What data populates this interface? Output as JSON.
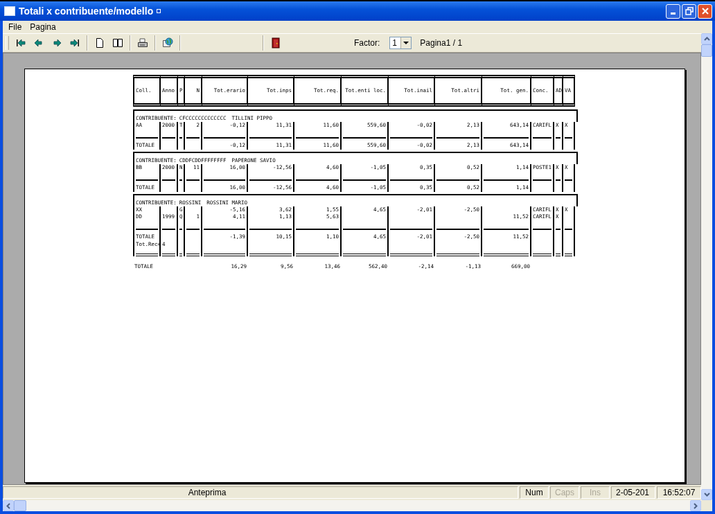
{
  "window": {
    "title": "Totali x contribuente/modello"
  },
  "menu": [
    {
      "label": "File"
    },
    {
      "label": "Pagina"
    }
  ],
  "toolbar": {
    "factor_label": "Factor:",
    "factor_value": "1",
    "page": "Pagina1 / 1"
  },
  "report": {
    "columns": [
      {
        "label": "Coll."
      },
      {
        "label": "Anno"
      },
      {
        "label": "P"
      },
      {
        "label": "N"
      },
      {
        "label": "Tot.erario"
      },
      {
        "label": "Tot.inps"
      },
      {
        "label": "Tot.req."
      },
      {
        "label": "Tot.enti loc."
      },
      {
        "label": "Tot.inail"
      },
      {
        "label": "Tot.altri"
      },
      {
        "label": "Tot. gen."
      },
      {
        "label": "Conc."
      },
      {
        "label": "AD"
      },
      {
        "label": "VA"
      }
    ],
    "groups": [
      {
        "label": "CONTRIBUENTE:",
        "code": "CFCCCCCCCCCCCCC",
        "name": "TILLINI PIPPO",
        "rows": [
          {
            "coll": "AA",
            "anno": "2000",
            "p": "T",
            "n": "2",
            "erario": "-0,12",
            "inps": "11,31",
            "req": "11,60",
            "enti_loc": "559,60",
            "inail": "-0,02",
            "altri": "2,13",
            "gen": "643,14",
            "conc": "CARIFL",
            "ad": "X",
            "va": "X"
          }
        ],
        "total": {
          "coll": "TOTALE",
          "erario": "-0,12",
          "inps": "11,31",
          "req": "11,60",
          "enti_loc": "559,60",
          "inail": "-0,02",
          "altri": "2,13",
          "gen": "643,14"
        }
      },
      {
        "label": "CONTRIBUENTE:",
        "code": "CDDFCDDFFFFFFFF",
        "name": "PAPERONE SAVIO",
        "rows": [
          {
            "coll": "BB",
            "anno": "2000",
            "p": "N",
            "n": "11",
            "erario": "16,00",
            "inps": "-12,56",
            "req": "4,60",
            "enti_loc": "-1,05",
            "inail": "0,35",
            "altri": "0,52",
            "gen": "1,14",
            "conc": "POSTE1",
            "ad": "X",
            "va": "X"
          }
        ],
        "total": {
          "coll": "TOTALE",
          "erario": "16,00",
          "inps": "-12,56",
          "req": "4,60",
          "enti_loc": "-1,05",
          "inail": "0,35",
          "altri": "0,52",
          "gen": "1,14"
        }
      },
      {
        "label": "CONTRIBUENTE:",
        "code": "ROSSINI",
        "name": "ROSSINI MARIO",
        "rows": [
          {
            "coll": "XX",
            "p": "G",
            "erario": "-5,16",
            "inps": "3,62",
            "req": "1,55",
            "enti_loc": "4,65",
            "inail": "-2,01",
            "altri": "-2,50",
            "conc": "CARIFL",
            "ad": "X",
            "va": "X"
          },
          {
            "coll": "DD",
            "anno": "1999",
            "p": "Q",
            "n": "1",
            "erario": "4,11",
            "inps": "1,13",
            "req": "5,63",
            "gen": "11,52",
            "conc": "CARIFL",
            "ad": "X"
          }
        ],
        "total": {
          "coll": "TOTALE",
          "erario": "-1,39",
          "inps": "10,15",
          "req": "1,10",
          "enti_loc": "4,65",
          "inail": "-2,01",
          "altri": "-2,50",
          "gen": "11,52"
        },
        "record_label": "Tot.Rec=",
        "record_count": "4"
      }
    ],
    "grand_total": {
      "coll": "TOTALE",
      "erario": "16,29",
      "inps": "9,56",
      "req": "13,46",
      "enti_loc": "562,40",
      "inail": "-2,14",
      "altri": "-1,13",
      "gen": "669,00"
    }
  },
  "status_bar": {
    "message": "Anteprima",
    "indicators": [
      {
        "label": "Num",
        "on": true
      },
      {
        "label": "Caps",
        "on": false
      },
      {
        "label": "Ins",
        "on": false
      }
    ],
    "date": "2-05-201",
    "time": "16:52:07"
  }
}
